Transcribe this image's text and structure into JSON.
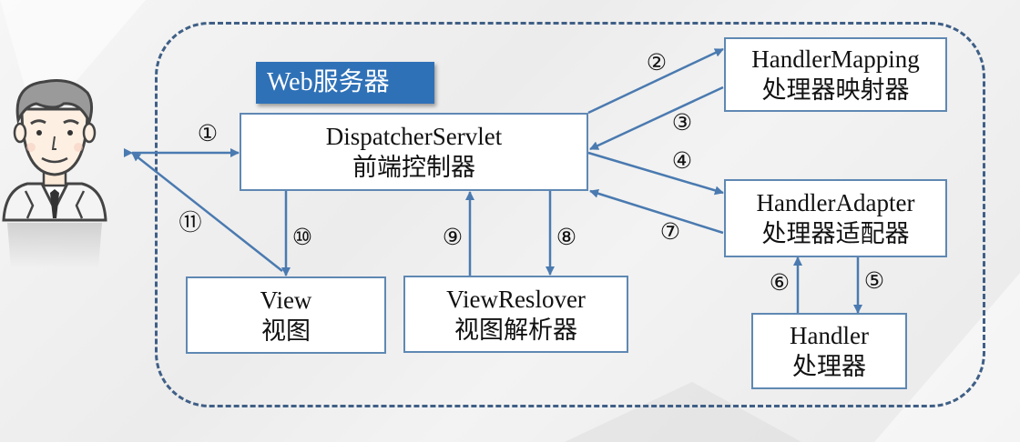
{
  "server_label": "Web服务器",
  "nodes": {
    "dispatcher": {
      "line1": "DispatcherServlet",
      "line2": "前端控制器"
    },
    "mapping": {
      "line1": "HandlerMapping",
      "line2": "处理器映射器"
    },
    "adapter": {
      "line1": "HandlerAdapter",
      "line2": "处理器适配器"
    },
    "handler": {
      "line1": "Handler",
      "line2": "处理器"
    },
    "view": {
      "line1": "View",
      "line2": "视图"
    },
    "resolver": {
      "line1": "ViewReslover",
      "line2": "视图解析器"
    }
  },
  "steps": [
    "①",
    "②",
    "③",
    "④",
    "⑤",
    "⑥",
    "⑦",
    "⑧",
    "⑨",
    "⑩",
    "⑪"
  ],
  "colors": {
    "frame": "#3f5f86",
    "box_border": "#5f88b3",
    "arrow": "#4a7ab0",
    "tag_bg": "#2f71b7"
  },
  "icons": {
    "user": "user-avatar-icon"
  }
}
